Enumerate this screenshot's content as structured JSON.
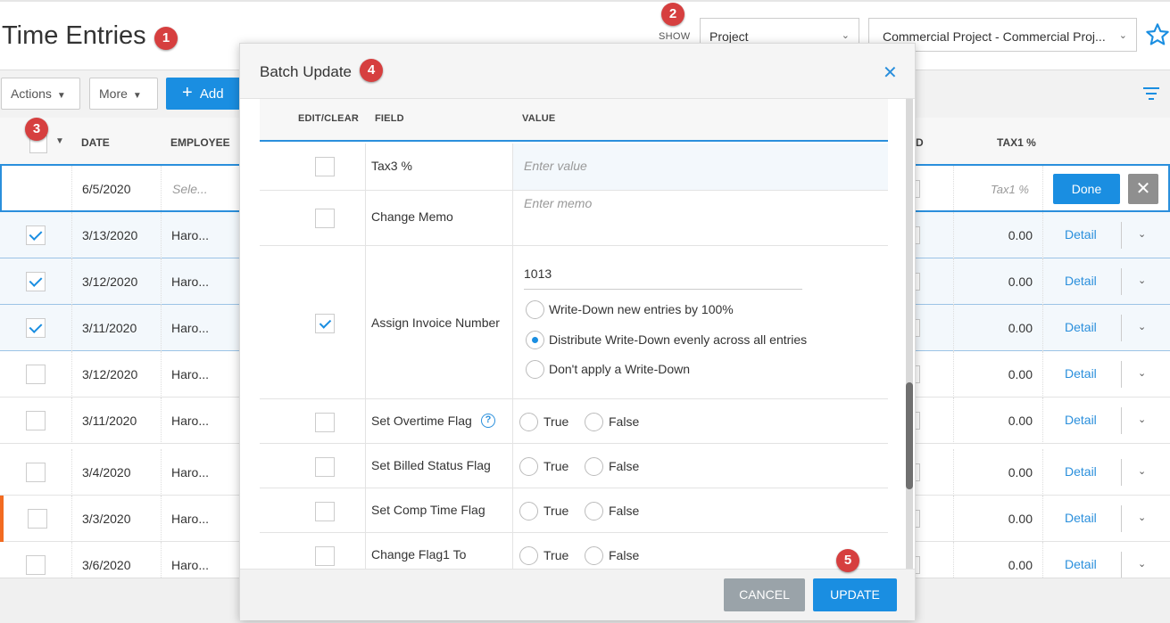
{
  "page": {
    "title": "Time Entries"
  },
  "filters": {
    "show_label": "SHOW",
    "show_by": "Project",
    "project": "Commercial Project - Commercial Proj..."
  },
  "toolbar": {
    "actions_label": "Actions",
    "more_label": "More",
    "add_label": "Add"
  },
  "grid": {
    "columns": {
      "date": "DATE",
      "employee": "EMPLOYEE",
      "partial": "D",
      "tax1": "TAX1 %"
    },
    "edit_row": {
      "date": "6/5/2020",
      "employee_placeholder": "Sele...",
      "tax1_placeholder": "Tax1 %",
      "done_label": "Done"
    },
    "rows": [
      {
        "checked": true,
        "date": "3/13/2020",
        "employee": "Haro...",
        "amount": "0.00",
        "detail": "Detail"
      },
      {
        "checked": true,
        "date": "3/12/2020",
        "employee": "Haro...",
        "amount": "0.00",
        "detail": "Detail"
      },
      {
        "checked": true,
        "date": "3/11/2020",
        "employee": "Haro...",
        "amount": "0.00",
        "detail": "Detail"
      },
      {
        "checked": false,
        "date": "3/12/2020",
        "employee": "Haro...",
        "amount": "0.00",
        "detail": "Detail"
      },
      {
        "checked": false,
        "date": "3/11/2020",
        "employee": "Haro...",
        "amount": "0.00",
        "detail": "Detail"
      },
      {
        "checked": false,
        "date": "3/4/2020",
        "employee": "Haro...",
        "amount": "0.00",
        "detail": "Detail"
      },
      {
        "checked": false,
        "date": "3/3/2020",
        "employee": "Haro...",
        "amount": "0.00",
        "detail": "Detail"
      },
      {
        "checked": false,
        "date": "3/6/2020",
        "employee": "Haro...",
        "amount": "0.00",
        "detail": "Detail"
      }
    ]
  },
  "modal": {
    "title": "Batch Update",
    "headers": {
      "edit_clear": "EDIT/CLEAR",
      "field": "FIELD",
      "value": "VALUE"
    },
    "tax3": {
      "label": "Tax3 %",
      "placeholder": "Enter value",
      "checked": false
    },
    "memo": {
      "label": "Change Memo",
      "placeholder": "Enter memo",
      "checked": false
    },
    "invoice": {
      "label": "Assign Invoice Number",
      "checked": true,
      "value": "1013",
      "options": [
        "Write-Down new entries by 100%",
        "Distribute Write-Down evenly across all entries",
        "Don't apply a Write-Down"
      ],
      "selected": "Distribute Write-Down evenly across all entries"
    },
    "flags": [
      {
        "label": "Set Overtime Flag",
        "has_help": true
      },
      {
        "label": "Set Billed Status Flag",
        "has_help": false
      },
      {
        "label": "Set Comp Time Flag",
        "has_help": false
      },
      {
        "label": "Change Flag1 To",
        "has_help": false
      }
    ],
    "true_label": "True",
    "false_label": "False",
    "cancel_label": "CANCEL",
    "update_label": "UPDATE"
  },
  "callouts": [
    "1",
    "2",
    "3",
    "4",
    "5"
  ],
  "colors": {
    "accent": "#1a8ee1",
    "badge": "#d63f3f",
    "flag": "#f26b21"
  }
}
